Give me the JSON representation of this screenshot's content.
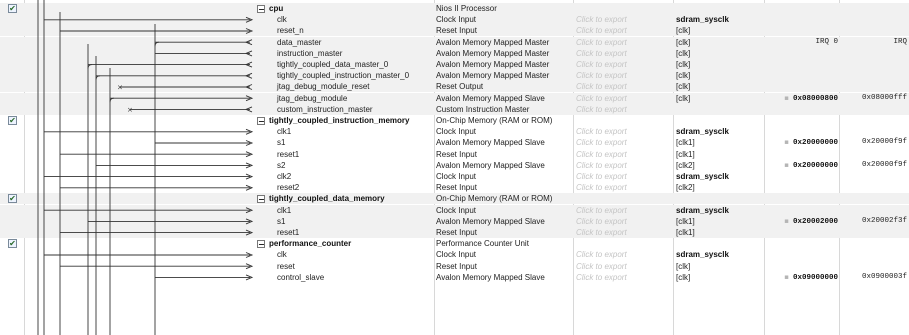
{
  "rows": [
    {
      "kind": "component",
      "name": "cpu",
      "desc": "Nios II Processor",
      "checked": true
    },
    {
      "kind": "port",
      "name": "clk",
      "desc": "Clock Input",
      "export": "Click to export",
      "clock": "sdram_sysclk",
      "clock_bold": true
    },
    {
      "kind": "port",
      "name": "reset_n",
      "desc": "Reset Input",
      "export": "Click to export",
      "clock": "[clk]"
    },
    {
      "kind": "port",
      "name": "data_master",
      "desc": "Avalon Memory Mapped Master",
      "export": "Click to export",
      "clock": "[clk]",
      "base": "IRQ 0",
      "end": "IRQ"
    },
    {
      "kind": "port",
      "name": "instruction_master",
      "desc": "Avalon Memory Mapped Master",
      "export": "Click to export",
      "clock": "[clk]"
    },
    {
      "kind": "port",
      "name": "tightly_coupled_data_master_0",
      "desc": "Avalon Memory Mapped Master",
      "export": "Click to export",
      "clock": "[clk]"
    },
    {
      "kind": "port",
      "name": "tightly_coupled_instruction_master_0",
      "desc": "Avalon Memory Mapped Master",
      "export": "Click to export",
      "clock": "[clk]"
    },
    {
      "kind": "port",
      "name": "jtag_debug_module_reset",
      "desc": "Reset Output",
      "export": "Click to export",
      "clock": "[clk]"
    },
    {
      "kind": "port",
      "name": "jtag_debug_module",
      "desc": "Avalon Memory Mapped Slave",
      "export": "Click to export",
      "clock": "[clk]",
      "base": "0x08000800",
      "end": "0x08000fff",
      "lock": true,
      "base_bold": true
    },
    {
      "kind": "port",
      "name": "custom_instruction_master",
      "desc": "Custom Instruction Master",
      "export": "Click to export",
      "clock": ""
    },
    {
      "kind": "component",
      "name": "tightly_coupled_instruction_memory",
      "desc": "On-Chip Memory (RAM or ROM)",
      "checked": true
    },
    {
      "kind": "port",
      "name": "clk1",
      "desc": "Clock Input",
      "export": "Click to export",
      "clock": "sdram_sysclk",
      "clock_bold": true
    },
    {
      "kind": "port",
      "name": "s1",
      "desc": "Avalon Memory Mapped Slave",
      "export": "Click to export",
      "clock": "[clk1]",
      "base": "0x20000000",
      "end": "0x20000f9f",
      "lock": true,
      "base_bold": true
    },
    {
      "kind": "port",
      "name": "reset1",
      "desc": "Reset Input",
      "export": "Click to export",
      "clock": "[clk1]"
    },
    {
      "kind": "port",
      "name": "s2",
      "desc": "Avalon Memory Mapped Slave",
      "export": "Click to export",
      "clock": "[clk2]",
      "base": "0x20000000",
      "end": "0x20000f9f",
      "lock": true,
      "base_bold": true
    },
    {
      "kind": "port",
      "name": "clk2",
      "desc": "Clock Input",
      "export": "Click to export",
      "clock": "sdram_sysclk",
      "clock_bold": true
    },
    {
      "kind": "port",
      "name": "reset2",
      "desc": "Reset Input",
      "export": "Click to export",
      "clock": "[clk2]"
    },
    {
      "kind": "component",
      "name": "tightly_coupled_data_memory",
      "desc": "On-Chip Memory (RAM or ROM)",
      "checked": true
    },
    {
      "kind": "port",
      "name": "clk1",
      "desc": "Clock Input",
      "export": "Click to export",
      "clock": "sdram_sysclk",
      "clock_bold": true
    },
    {
      "kind": "port",
      "name": "s1",
      "desc": "Avalon Memory Mapped Slave",
      "export": "Click to export",
      "clock": "[clk1]",
      "base": "0x20002000",
      "end": "0x20002f3f",
      "lock": true,
      "base_bold": true
    },
    {
      "kind": "port",
      "name": "reset1",
      "desc": "Reset Input",
      "export": "Click to export",
      "clock": "[clk1]"
    },
    {
      "kind": "component",
      "name": "performance_counter",
      "desc": "Performance Counter Unit",
      "checked": true
    },
    {
      "kind": "port",
      "name": "clk",
      "desc": "Clock Input",
      "export": "Click to export",
      "clock": "sdram_sysclk",
      "clock_bold": true
    },
    {
      "kind": "port",
      "name": "reset",
      "desc": "Reset Input",
      "export": "Click to export",
      "clock": "[clk]"
    },
    {
      "kind": "port",
      "name": "control_slave",
      "desc": "Avalon Memory Mapped Slave",
      "export": "Click to export",
      "clock": "[clk]",
      "base": "0x09000000",
      "end": "0x0900003f",
      "lock": true,
      "base_bold": true
    }
  ],
  "glyphs": {
    "collapse": "−",
    "check": "✔",
    "lock": "▪"
  },
  "colors": {
    "shade": "#f1f1f1",
    "wire": "#333333",
    "export_text": "#c4c4c4"
  }
}
